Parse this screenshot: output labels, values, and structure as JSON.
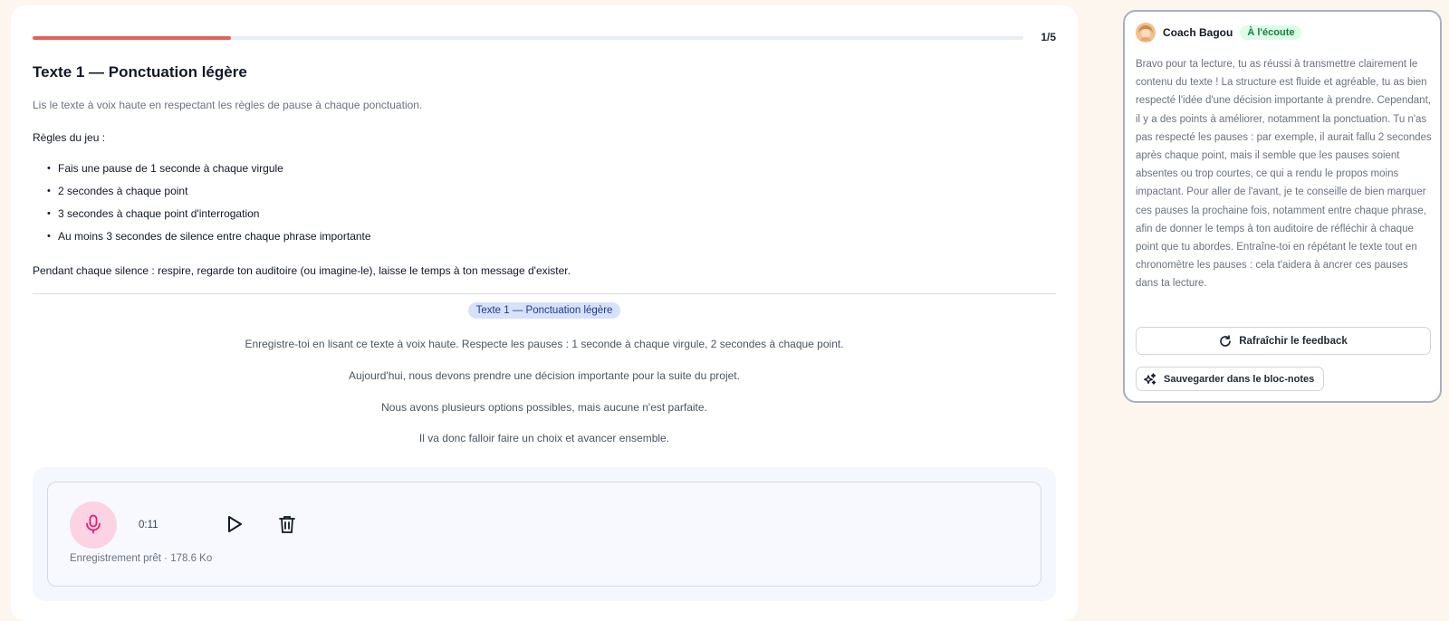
{
  "exercise": {
    "progress": {
      "fraction": 0.2,
      "label": "1/5"
    },
    "title": "Texte 1 — Ponctuation légère",
    "instruction": "Lis le texte à voix haute en respectant les règles de pause à chaque ponctuation.",
    "rules_heading": "Règles du jeu :",
    "rules": [
      "Fais une pause de 1 seconde à chaque virgule",
      "2 secondes à chaque point",
      "3 secondes à chaque point d'interrogation",
      "Au moins 3 secondes de silence entre chaque phrase importante"
    ],
    "silence_note": "Pendant chaque silence : respire, regarde ton auditoire (ou imagine-le), laisse le temps à ton message d'exister.",
    "text_pill": "Texte 1 — Ponctuation légère",
    "text_instruction": "Enregistre-toi en lisant ce texte à voix haute. Respecte les pauses : 1 seconde à chaque virgule, 2 secondes à chaque point.",
    "text_lines": [
      "Aujourd'hui, nous devons prendre une décision importante pour la suite du projet.",
      "Nous avons plusieurs options possibles, mais aucune n'est parfaite.",
      "Il va donc falloir faire un choix et avancer ensemble."
    ]
  },
  "recorder": {
    "timer": "0:11",
    "status": "Enregistrement prêt · 178.6 Ko",
    "icons": {
      "mic": "microphone-icon",
      "play": "play-icon",
      "delete": "trash-icon"
    },
    "colors": {
      "mic_bg": "#fcd3e2",
      "mic_icon": "#e11d74"
    }
  },
  "coach": {
    "name": "Coach Bagou",
    "status": "À l'écoute",
    "feedback": "Bravo pour ta lecture, tu as réussi à transmettre clairement le contenu du texte ! La structure est fluide et agréable, tu as bien respecté l'idée d'une décision importante à prendre. Cependant, il y a des points à améliorer, notamment la ponctuation. Tu n'as pas respecté les pauses : par exemple, il aurait fallu 2 secondes après chaque point, mais il semble que les pauses soient absentes ou trop courtes, ce qui a rendu le propos moins impactant. Pour aller de l'avant, je te conseille de bien marquer ces pauses la prochaine fois, notamment entre chaque phrase, afin de donner le temps à ton auditoire de réfléchir à chaque point que tu abordes. Entraîne-toi en répétant le texte tout en chronomètre les pauses : cela t'aidera à ancrer ces pauses dans ta lecture.",
    "refresh_label": "Rafraîchir le feedback",
    "save_label": "Sauvegarder dans le bloc-notes",
    "colors": {
      "badge_bg": "#dcfce7",
      "badge_text": "#15803d",
      "accent": "#e4605a"
    }
  }
}
